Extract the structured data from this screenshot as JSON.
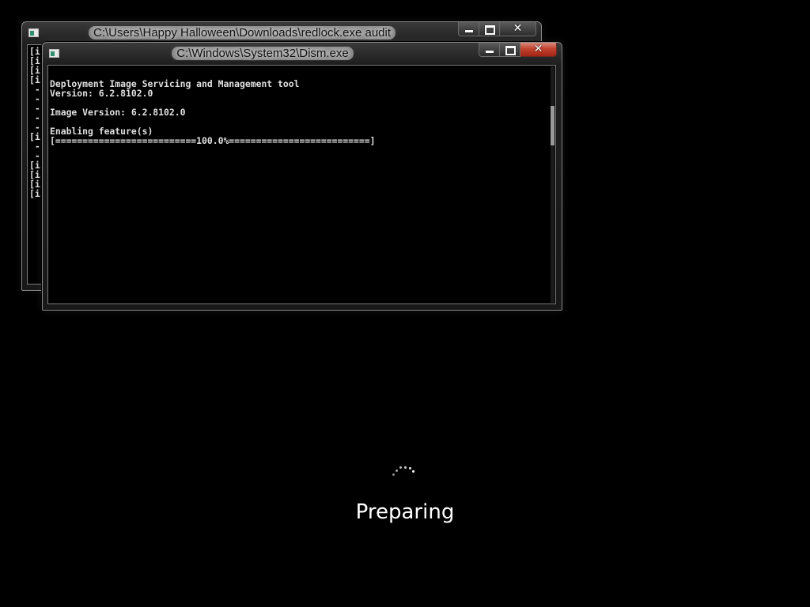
{
  "windows": {
    "back": {
      "title": "C:\\Users\\Happy Halloween\\Downloads\\redlock.exe audit",
      "console_lines": "[i\n[i\n[i\n[i\n -\n -\n -\n -\n -\n[i\n -\n -\n[i\n[i\n[i\n[i"
    },
    "front": {
      "title": "C:\\Windows\\System32\\Dism.exe",
      "console_lines": "Deployment Image Servicing and Management tool\nVersion: 6.2.8102.0\n\nImage Version: 6.2.8102.0\n\nEnabling feature(s)\n[==========================100.0%==========================]",
      "progress_percent": 100.0
    },
    "caption_buttons": {
      "minimize_icon": "minimize-icon",
      "maximize_icon": "maximize-icon",
      "close_icon": "close-icon",
      "close_glyph": "✕"
    }
  },
  "status": {
    "text": "Preparing",
    "spinner_icon": "loading-spinner-icon"
  },
  "colors": {
    "background": "#000000",
    "close_button_active": "#c1432f",
    "console_text": "#e0e0e0",
    "status_text": "#ffffff"
  }
}
